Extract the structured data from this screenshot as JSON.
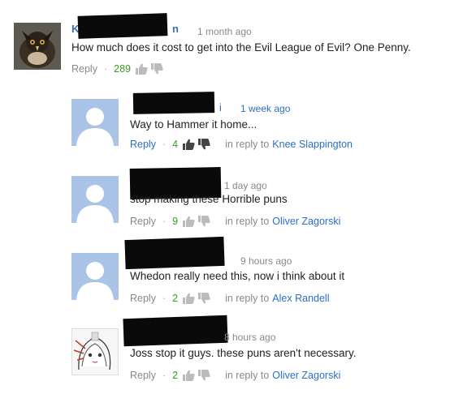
{
  "comments": [
    {
      "avatar": "hawk-avatar",
      "name_frag_left": "K",
      "name_frag_right": "n",
      "time": "1 month ago",
      "text": "How much does it cost to get into the Evil League of Evil? One Penny.",
      "reply": "Reply",
      "likes": "289",
      "in_reply_to_prefix": "",
      "in_reply_to_name": ""
    },
    {
      "avatar": "default-avatar",
      "name_frag_left": "",
      "name_frag_right": "i",
      "time": "1 week ago",
      "text": "Way to Hammer it home...",
      "reply": "Reply",
      "likes": "4",
      "in_reply_to_prefix": "in reply to",
      "in_reply_to_name": "Knee Slappington"
    },
    {
      "avatar": "default-avatar",
      "name_frag_left": "",
      "name_frag_right": "",
      "time": "1 day ago",
      "text": "stop making these Horrible puns",
      "reply": "Reply",
      "likes": "9",
      "in_reply_to_prefix": "in reply to",
      "in_reply_to_name": "Oliver Zagorski"
    },
    {
      "avatar": "default-avatar",
      "name_frag_left": "",
      "name_frag_right": "",
      "time": "9 hours ago",
      "text": "Whedon really need this, now i think about it",
      "reply": "Reply",
      "likes": "2",
      "in_reply_to_prefix": "in reply to",
      "in_reply_to_name": "Alex Randell"
    },
    {
      "avatar": "anime-avatar",
      "name_frag_left": "",
      "name_frag_right": "",
      "time": "8 hours ago",
      "text": "Joss stop it guys. these puns aren't necessary.",
      "reply": "Reply",
      "likes": "2",
      "in_reply_to_prefix": "in reply to",
      "in_reply_to_name": "Oliver Zagorski"
    }
  ]
}
